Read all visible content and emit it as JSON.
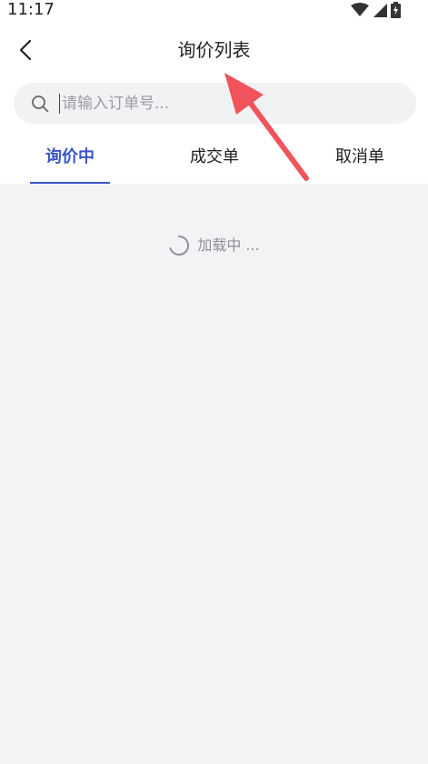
{
  "status_bar": {
    "time": "11:17",
    "icons": [
      "wifi-icon",
      "signal-icon",
      "battery-charging-icon"
    ]
  },
  "nav": {
    "back_icon": "chevron-left-icon",
    "title": "询价列表"
  },
  "search": {
    "icon": "search-icon",
    "placeholder": "请输入订单号...",
    "value": ""
  },
  "tabs": [
    {
      "label": "询价中",
      "active": true
    },
    {
      "label": "成交单",
      "active": false
    },
    {
      "label": "取消单",
      "active": false
    }
  ],
  "loading": {
    "icon": "spinner-icon",
    "text": "加载中 ..."
  },
  "colors": {
    "accent": "#3c55c9",
    "annotation_arrow": "#f0545a",
    "page_background": "#f2f3f5"
  }
}
